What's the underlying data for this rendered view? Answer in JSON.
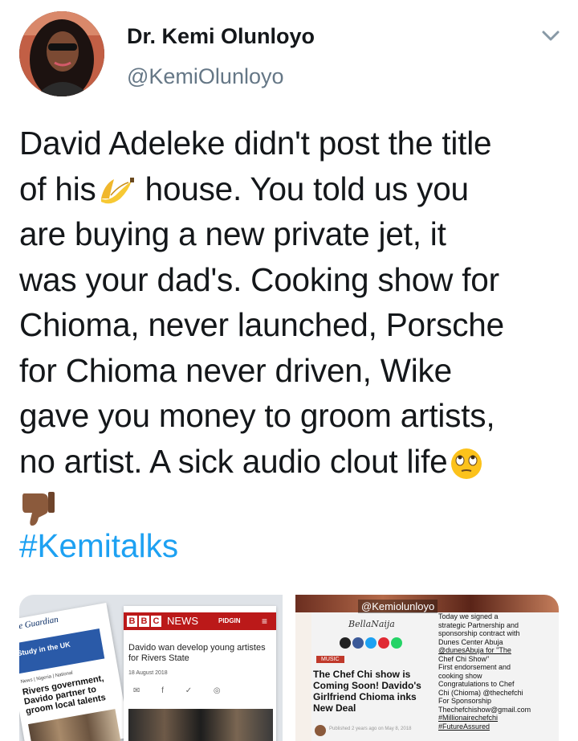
{
  "author": {
    "display_name": "Dr. Kemi Olunloyo",
    "handle": "@KemiOlunloyo"
  },
  "tweet": {
    "lines": [
      "David Adeleke didn't post the title",
      [
        "of his",
        " house. You told us you"
      ],
      "are buying a new private jet, it",
      "was your dad's. Cooking show for",
      "Chioma, never launched, Porsche",
      "for Chioma never driven, Wike",
      "gave you money to groom artists,",
      "no artist. A sick audio clout life"
    ],
    "line1": "David Adeleke didn't post the title",
    "line2a": "of his",
    "line2b": " house. You told us you",
    "line3": "are buying a new private jet, it",
    "line4": "was your dad's. Cooking show for",
    "line5": "Chioma, never launched, Porsche",
    "line6": "for Chioma never driven, Wike",
    "line7": "gave you money to groom artists,",
    "line8": "no artist. A sick audio clout life",
    "emojis": [
      "banana-emoji",
      "face-with-rolling-eyes-emoji",
      "thumbs-down-emoji"
    ],
    "hashtag": "#Kemitalks"
  },
  "media": {
    "left": {
      "guardian_logo": "The Guardian",
      "guardian_banner": "Study in the UK",
      "guardian_tags": "News | Nigeria | National",
      "guardian_headline": "Rivers government, Davido partner to groom local talents",
      "bbc_letters": [
        "B",
        "B",
        "C"
      ],
      "bbc_news": "NEWS",
      "bbc_pidgin": "PIDGIN",
      "bbc_headline": "Davido wan develop young artistes for Rivers State",
      "bbc_date": "18 August 2018"
    },
    "right": {
      "watermark": "@Kemiolunloyo",
      "site": "BellaNaija",
      "music_tag": "MUSIC",
      "headline": "The Chef Chi show is Coming Soon! Davido's Girlfriend Chioma inks New Deal",
      "footer": "Published 2 years ago on May 8, 2018",
      "caption_lines": [
        "Today we signed a",
        "strategic Partnership and",
        "sponsorship contract with",
        "Dunes Center Abuja",
        "@dunesAbuja for \"The",
        "Chef Chi Show\"",
        "First endorsement and",
        "cooking show",
        "Congratulations to Chef",
        "Chi (Chioma) @thechefchi",
        "For Sponsorship",
        "Thechefchishow@gmail.com",
        "#Millionairechefchi",
        "#FutureAssured"
      ]
    }
  },
  "colors": {
    "text": "#14171a",
    "secondary": "#657786",
    "link": "#1da1f2",
    "bbc_red": "#bb1919"
  }
}
